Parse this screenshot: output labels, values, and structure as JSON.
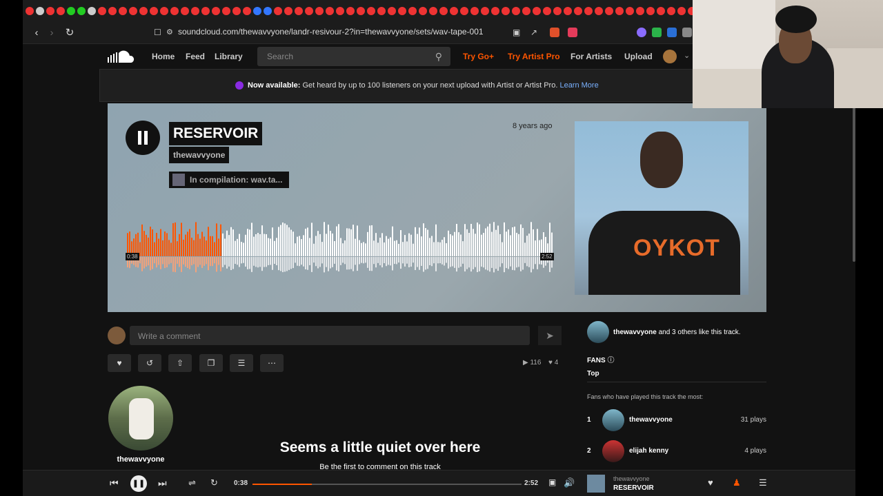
{
  "browser": {
    "url": "soundcloud.com/thewavvyone/landr-resivour-2?in=thewavvyone/sets/wav-tape-001"
  },
  "header": {
    "nav": [
      "Home",
      "Feed",
      "Library"
    ],
    "search_placeholder": "Search",
    "try_go": "Try Go+",
    "try_artist": "Try Artist Pro",
    "for_artists": "For Artists",
    "upload": "Upload"
  },
  "banner": {
    "bold": "Now available:",
    "text": " Get heard by up to 100 listeners on your next upload with Artist or Artist Pro. ",
    "link": "Learn More"
  },
  "track": {
    "title": "RESERVOIR",
    "artist": "thewavvyone",
    "compilation": "In compilation: wav.ta...",
    "age": "8 years ago",
    "current_time": "0:38",
    "duration": "2:52",
    "progress": 0.22,
    "art_text": "OYKOT"
  },
  "comment": {
    "placeholder": "Write a comment"
  },
  "stats": {
    "plays": "116",
    "likes": "4"
  },
  "uploader": {
    "name": "thewavvyone"
  },
  "empty": {
    "heading": "Seems a little quiet over here",
    "sub": "Be the first to comment on this track"
  },
  "sidebar": {
    "likes_user": "thewavvyone",
    "likes_text": " and 3 others like this track.",
    "fans_title": "FANS",
    "tab_top": "Top",
    "fans_desc": "Fans who have played this track the most:",
    "fans": [
      {
        "rank": "1",
        "name": "thewavvyone",
        "plays": "31 plays"
      },
      {
        "rank": "2",
        "name": "elijah kenny",
        "plays": "4 plays"
      }
    ]
  },
  "player": {
    "current": "0:38",
    "duration": "2:52",
    "artist": "thewavvyone",
    "title": "RESERVOIR"
  },
  "colors": {
    "accent": "#ff5500",
    "link": "#7ab1ff"
  }
}
